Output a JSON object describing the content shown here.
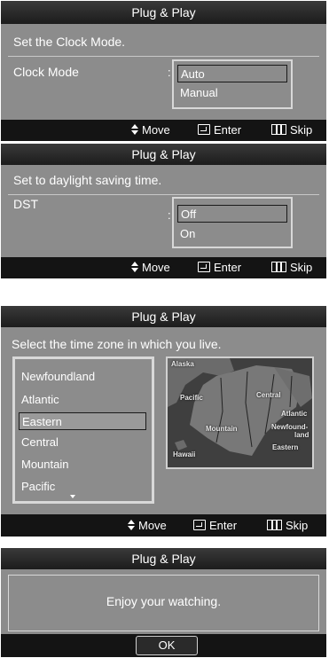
{
  "screen1": {
    "title": "Plug & Play",
    "prompt": "Set the Clock Mode.",
    "field_label": "Clock Mode",
    "colon": ":",
    "options": [
      "Auto",
      "Manual"
    ],
    "selected_index": 0,
    "footer": {
      "move": "Move",
      "enter": "Enter",
      "skip": "Skip"
    }
  },
  "screen2": {
    "title": "Plug & Play",
    "prompt": "Set to daylight saving time.",
    "field_label": "DST",
    "colon": ":",
    "options": [
      "Off",
      "On"
    ],
    "selected_index": 0,
    "footer": {
      "move": "Move",
      "enter": "Enter",
      "skip": "Skip"
    }
  },
  "screen3": {
    "title": "Plug & Play",
    "prompt": "Select the time zone in which you live.",
    "timezones": [
      "Newfoundland",
      "Atlantic",
      "Eastern",
      "Central",
      "Mountain",
      "Pacific"
    ],
    "selected_index": 2,
    "map_labels": {
      "alaska": "Alaska",
      "pacific": "Pacific",
      "central": "Central",
      "atlantic": "Atlantic",
      "newfoundland_1": "Newfound-",
      "newfoundland_2": "land",
      "mountain": "Mountain",
      "eastern": "Eastern",
      "hawaii": "Hawaii"
    },
    "footer": {
      "move": "Move",
      "enter": "Enter",
      "skip": "Skip"
    }
  },
  "screen4": {
    "title": "Plug & Play",
    "message": "Enjoy your watching.",
    "ok_label": "OK"
  },
  "colors": {
    "panel": "#8c8c8c",
    "title_bar": "#2a2a2a",
    "footer": "#141414",
    "border": "#d8d8d8"
  }
}
